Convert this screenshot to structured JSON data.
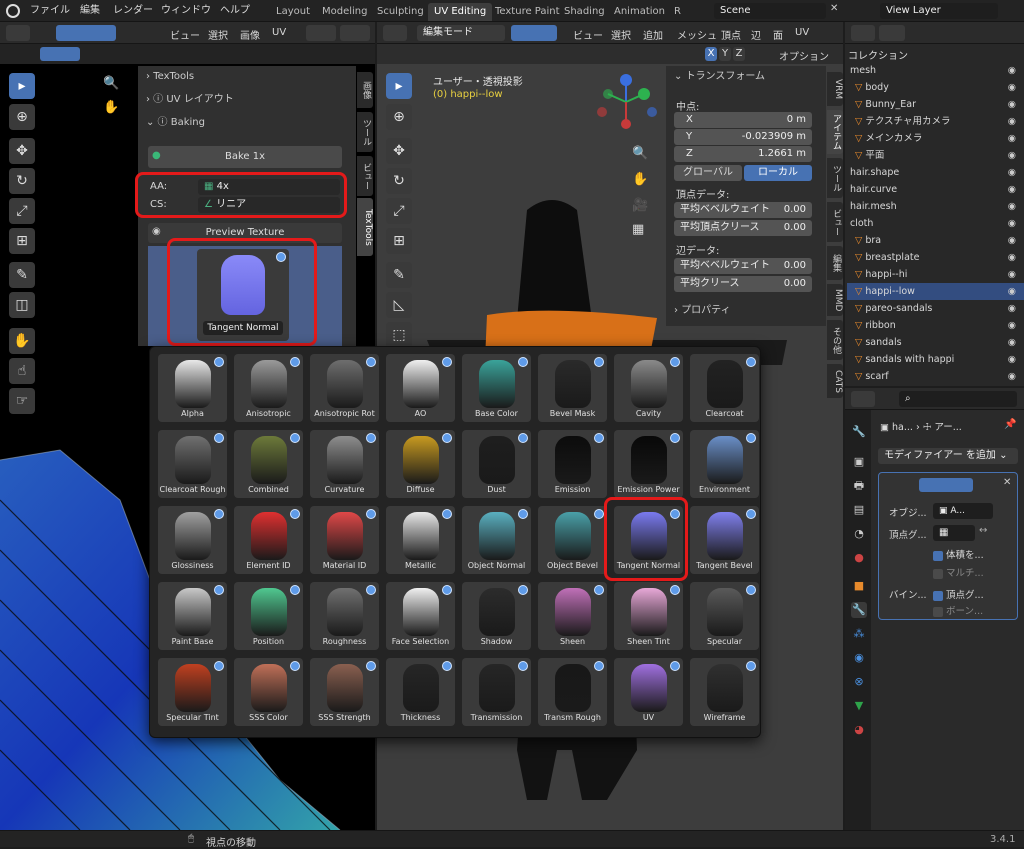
{
  "menubar": {
    "items": [
      "ファイル",
      "編集",
      "レンダー",
      "ウィンドウ",
      "ヘルプ"
    ],
    "workspaces": [
      "Layout",
      "Modeling",
      "Sculpting",
      "UV Editing",
      "Texture Paint",
      "Shading",
      "Animation",
      "R"
    ],
    "scene": "Scene",
    "view_layer": "View Layer"
  },
  "uv_editor": {
    "header_items": [
      "ビュー",
      "選択",
      "画像",
      "UV"
    ],
    "tabs": [
      "TexTools",
      "UV レイアウト",
      "Baking"
    ],
    "bake_button": "Bake 1x",
    "aa_label": "AA:",
    "aa_value": "4x",
    "cs_label": "CS:",
    "cs_value": "リニア",
    "preview_label": "Preview Texture",
    "preview_name": "Tangent Normal",
    "side_tabs": [
      "画像",
      "ツール",
      "ビュー",
      "TexTools"
    ]
  },
  "viewport": {
    "mode": "編集モード",
    "header_items": [
      "ビュー",
      "選択",
      "追加",
      "メッシュ",
      "頂点",
      "辺",
      "面",
      "UV"
    ],
    "axes": [
      "X",
      "Y",
      "Z"
    ],
    "options": "オプション",
    "view_title": "ユーザー・透視投影",
    "object_name": "(0) happi--low",
    "side_tabs": [
      "VRM",
      "アイテム",
      "ツール",
      "ビュー",
      "編集",
      "MMD",
      "その他",
      "CATS"
    ],
    "status": "視点の移動"
  },
  "transform": {
    "title": "トランスフォーム",
    "median": "中点:",
    "fields": [
      {
        "axis": "X",
        "value": "0 m"
      },
      {
        "axis": "Y",
        "value": "-0.023909 m"
      },
      {
        "axis": "Z",
        "value": "1.2661 m"
      }
    ],
    "global": "グローバル",
    "local": "ローカル",
    "vertex_data": "頂点データ:",
    "edge_data": "辺データ:",
    "vert_rows": [
      {
        "label": "平均ベベルウェイト",
        "value": "0.00"
      },
      {
        "label": "平均頂点クリース",
        "value": "0.00"
      }
    ],
    "edge_rows": [
      {
        "label": "平均ベベルウェイト",
        "value": "0.00"
      },
      {
        "label": "平均クリース",
        "value": "0.00"
      }
    ],
    "properties": "プロパティ"
  },
  "texture_grid": {
    "items": [
      {
        "name": "Alpha",
        "color": "#e8e8e8"
      },
      {
        "name": "Anisotropic",
        "color": "#9a9a9a"
      },
      {
        "name": "Anisotropic Rot",
        "color": "#6e6e6e"
      },
      {
        "name": "AO",
        "color": "#f0f0f0"
      },
      {
        "name": "Base Color",
        "color": "#3aa39a"
      },
      {
        "name": "Bevel Mask",
        "color": "#2a2a2a"
      },
      {
        "name": "Cavity",
        "color": "#8a8a8a"
      },
      {
        "name": "Clearcoat",
        "color": "#222222"
      },
      {
        "name": "Clearcoat Rough",
        "color": "#707070"
      },
      {
        "name": "Combined",
        "color": "#6d7a3a"
      },
      {
        "name": "Curvature",
        "color": "#8e8e8e"
      },
      {
        "name": "Diffuse",
        "color": "#c89a20"
      },
      {
        "name": "Dust",
        "color": "#1e1e1e"
      },
      {
        "name": "Emission",
        "color": "#0c0c0c"
      },
      {
        "name": "Emission Power",
        "color": "#080808"
      },
      {
        "name": "Environment",
        "color": "#6a8fc8"
      },
      {
        "name": "Glossiness",
        "color": "#a0a0a0"
      },
      {
        "name": "Element ID",
        "color": "#e03030"
      },
      {
        "name": "Material ID",
        "color": "#e04848"
      },
      {
        "name": "Metallic",
        "color": "#e8e8e8"
      },
      {
        "name": "Object Normal",
        "color": "#5ab0c0"
      },
      {
        "name": "Object Bevel",
        "color": "#4aa0a8"
      },
      {
        "name": "Tangent Normal",
        "color": "#7a7af0"
      },
      {
        "name": "Tangent Bevel",
        "color": "#8080ee"
      },
      {
        "name": "Paint Base",
        "color": "#c8c8c8"
      },
      {
        "name": "Position",
        "color": "#50c890"
      },
      {
        "name": "Roughness",
        "color": "#707070"
      },
      {
        "name": "Face Selection",
        "color": "#f0f0f0"
      },
      {
        "name": "Shadow",
        "color": "#2c2c2c"
      },
      {
        "name": "Sheen",
        "color": "#c070b8"
      },
      {
        "name": "Sheen Tint",
        "color": "#e8a8d8"
      },
      {
        "name": "Specular",
        "color": "#5a5a5a"
      },
      {
        "name": "Specular Tint",
        "color": "#c04020"
      },
      {
        "name": "SSS Color",
        "color": "#c07058"
      },
      {
        "name": "SSS Strength",
        "color": "#8a6050"
      },
      {
        "name": "Thickness",
        "color": "#262626"
      },
      {
        "name": "Transmission",
        "color": "#262626"
      },
      {
        "name": "Transm Rough",
        "color": "#181818"
      },
      {
        "name": "UV",
        "color": "#a070e0"
      },
      {
        "name": "Wireframe",
        "color": "#303030"
      }
    ]
  },
  "outliner": {
    "title": "コレクション",
    "rows": [
      {
        "name": "mesh",
        "indent": 0,
        "kind": "collection"
      },
      {
        "name": "body",
        "indent": 1,
        "kind": "object"
      },
      {
        "name": "Bunny_Ear",
        "indent": 1,
        "kind": "object"
      },
      {
        "name": "テクスチャ用カメラ",
        "indent": 1,
        "kind": "object"
      },
      {
        "name": "メインカメラ",
        "indent": 1,
        "kind": "object"
      },
      {
        "name": "平面",
        "indent": 1,
        "kind": "object"
      },
      {
        "name": "hair.shape",
        "indent": 0,
        "kind": "collection"
      },
      {
        "name": "hair.curve",
        "indent": 0,
        "kind": "collection"
      },
      {
        "name": "hair.mesh",
        "indent": 0,
        "kind": "collection"
      },
      {
        "name": "cloth",
        "indent": 0,
        "kind": "collection"
      },
      {
        "name": "bra",
        "indent": 1,
        "kind": "object"
      },
      {
        "name": "breastplate",
        "indent": 1,
        "kind": "object"
      },
      {
        "name": "happi--hi",
        "indent": 1,
        "kind": "object"
      },
      {
        "name": "happi--low",
        "indent": 1,
        "kind": "object"
      },
      {
        "name": "pareo-sandals",
        "indent": 1,
        "kind": "object"
      },
      {
        "name": "ribbon",
        "indent": 1,
        "kind": "object"
      },
      {
        "name": "sandals",
        "indent": 1,
        "kind": "object"
      },
      {
        "name": "sandals with happi",
        "indent": 1,
        "kind": "object"
      },
      {
        "name": "scarf",
        "indent": 1,
        "kind": "object"
      }
    ]
  },
  "properties": {
    "object": "ha...",
    "armature": "アー...",
    "add_modifier": "モディファイアー を追加",
    "object_label": "オブジ...",
    "object_value": "A...",
    "vgroup_label": "頂点グ...",
    "preserve_volume": "体積を...",
    "multi": "マルチ...",
    "bind_label": "バイン...",
    "bind_vertex": "頂点グ...",
    "bind_bone": "ボーン..."
  },
  "version": "3.4.1"
}
